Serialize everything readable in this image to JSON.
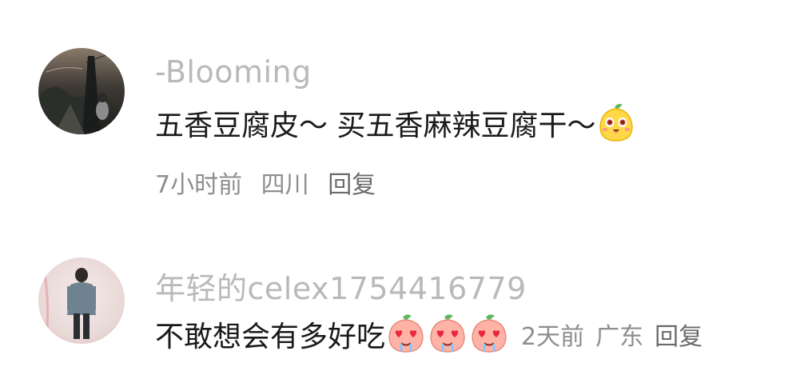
{
  "comments": [
    {
      "username": "-Blooming",
      "text": "五香豆腐皮～ 买五香麻辣豆腐干～",
      "emoji": "mango-smile-icon",
      "time": "7小时前",
      "location": "四川",
      "reply_label": "回复"
    },
    {
      "username": "年轻的celex1754416779",
      "text": "不敢想会有多好吃",
      "emoji": "peach-heart-eyes-drool-icon",
      "emoji_count": 3,
      "time": "2天前",
      "location": "广东",
      "reply_label": "回复"
    }
  ]
}
